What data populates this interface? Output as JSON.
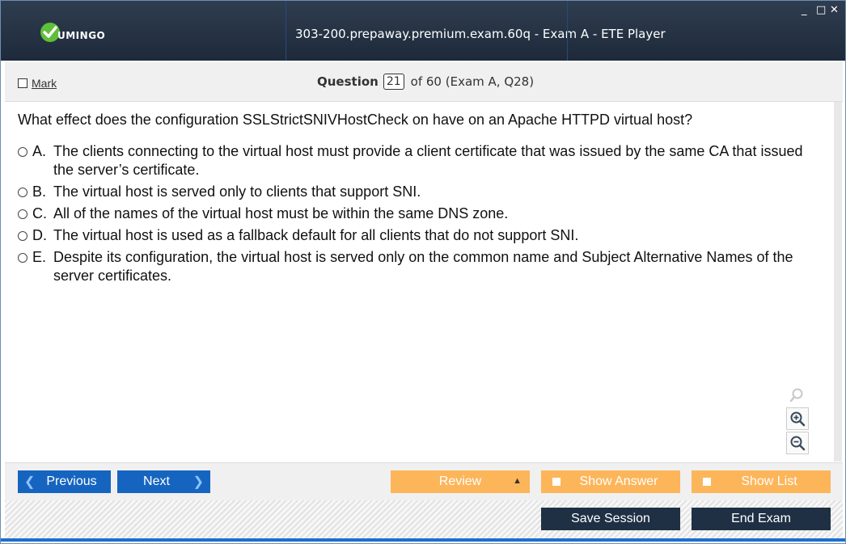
{
  "app": {
    "title": "303-200.prepaway.premium.exam.60q - Exam A - ETE Player",
    "logo_text": "UMINGO",
    "window_controls": {
      "minimize": "_",
      "maximize": "□",
      "close": "✕"
    }
  },
  "header": {
    "mark_label": "Mark",
    "question_label": "Question",
    "question_number": "21",
    "question_suffix": "of 60 (Exam A, Q28)"
  },
  "question": {
    "text": "What effect does the configuration SSLStrictSNIVHostCheck on have on an Apache HTTPD virtual host?",
    "options": [
      {
        "letter": "A.",
        "text": "The clients connecting to the virtual host must provide a client certificate that was issued by the same CA that issued the server’s certificate."
      },
      {
        "letter": "B.",
        "text": "The virtual host is served only to clients that support SNI."
      },
      {
        "letter": "C.",
        "text": "All of the names of the virtual host must be within the same DNS zone."
      },
      {
        "letter": "D.",
        "text": "The virtual host is used as a fallback default for all clients that do not support SNI."
      },
      {
        "letter": "E.",
        "text": "Despite its configuration, the virtual host is served only on the common name and Subject Alternative Names of the server certificates."
      }
    ]
  },
  "zoom": {
    "icons": [
      "search-icon",
      "zoom-in-icon",
      "zoom-out-icon"
    ]
  },
  "nav": {
    "previous_label": "Previous",
    "next_label": "Next",
    "review_label": "Review",
    "show_answer_label": "Show Answer",
    "show_list_label": "Show List",
    "save_session_label": "Save Session",
    "end_exam_label": "End Exam"
  },
  "colors": {
    "titlebar": "#1e2a3a",
    "nav_blue": "#1565c0",
    "review_orange": "#fdb55a",
    "dark_button": "#1f3045",
    "accent_line": "#1e6fd0",
    "logo_green": "#5fbf3a"
  }
}
